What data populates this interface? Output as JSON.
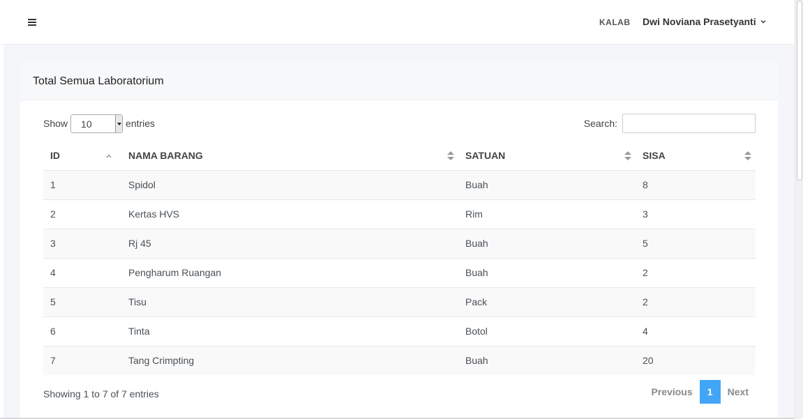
{
  "header": {
    "role": "KALAB",
    "user_name": "Dwi Noviana Prasetyanti"
  },
  "card": {
    "title": "Total Semua Laboratorium"
  },
  "controls": {
    "show_label": "Show",
    "entries_value": "10",
    "entries_label": "entries",
    "search_label": "Search:",
    "search_value": ""
  },
  "table": {
    "columns": [
      "ID",
      "NAMA BARANG",
      "SATUAN",
      "SISA"
    ],
    "rows": [
      [
        "1",
        "Spidol",
        "Buah",
        "8"
      ],
      [
        "2",
        "Kertas HVS",
        "Rim",
        "3"
      ],
      [
        "3",
        "Rj 45",
        "Buah",
        "5"
      ],
      [
        "4",
        "Pengharum Ruangan",
        "Buah",
        "2"
      ],
      [
        "5",
        "Tisu",
        "Pack",
        "2"
      ],
      [
        "6",
        "Tinta",
        "Botol",
        "4"
      ],
      [
        "7",
        "Tang Crimpting",
        "Buah",
        "20"
      ]
    ]
  },
  "footer": {
    "info": "Showing 1 to 7 of 7 entries",
    "previous": "Previous",
    "page": "1",
    "next": "Next"
  },
  "colors": {
    "accent": "#42a5f5"
  }
}
